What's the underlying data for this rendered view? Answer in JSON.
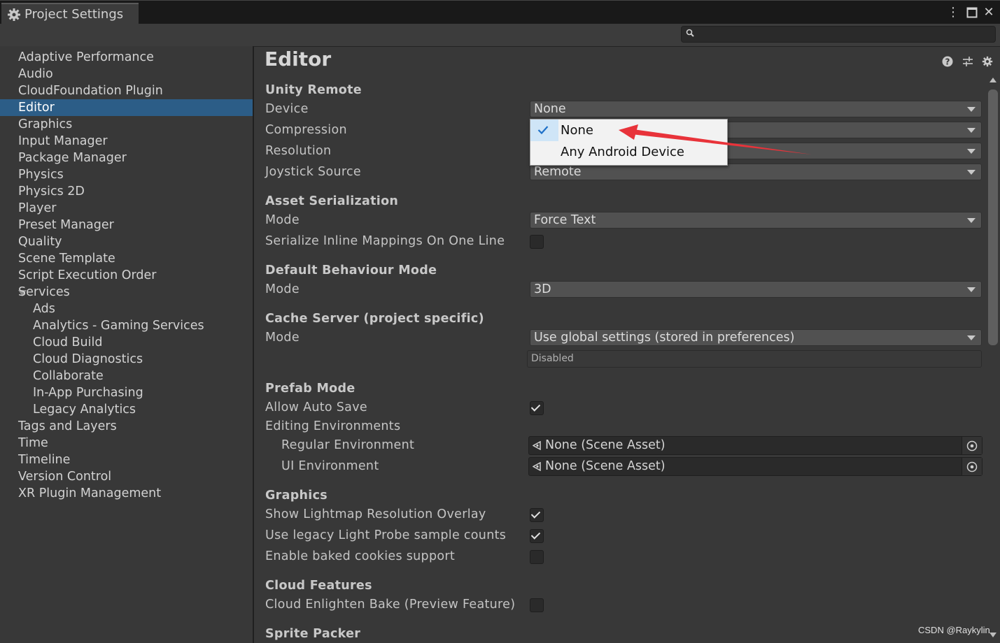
{
  "window": {
    "tab_title": "Project Settings",
    "buttons": [
      "menu-icon",
      "maximize-icon",
      "close-icon"
    ]
  },
  "search": {
    "placeholder": "",
    "value": ""
  },
  "sidebar": {
    "items": [
      {
        "label": "Adaptive Performance"
      },
      {
        "label": "Audio"
      },
      {
        "label": "CloudFoundation Plugin"
      },
      {
        "label": "Editor",
        "selected": true
      },
      {
        "label": "Graphics"
      },
      {
        "label": "Input Manager"
      },
      {
        "label": "Package Manager"
      },
      {
        "label": "Physics"
      },
      {
        "label": "Physics 2D"
      },
      {
        "label": "Player"
      },
      {
        "label": "Preset Manager"
      },
      {
        "label": "Quality"
      },
      {
        "label": "Scene Template"
      },
      {
        "label": "Script Execution Order"
      },
      {
        "label": "Services",
        "expanded": true
      },
      {
        "label": "Ads",
        "child": true
      },
      {
        "label": "Analytics - Gaming Services",
        "child": true
      },
      {
        "label": "Cloud Build",
        "child": true
      },
      {
        "label": "Cloud Diagnostics",
        "child": true
      },
      {
        "label": "Collaborate",
        "child": true
      },
      {
        "label": "In-App Purchasing",
        "child": true
      },
      {
        "label": "Legacy Analytics",
        "child": true
      },
      {
        "label": "Tags and Layers"
      },
      {
        "label": "Time"
      },
      {
        "label": "Timeline"
      },
      {
        "label": "Version Control"
      },
      {
        "label": "XR Plugin Management"
      }
    ]
  },
  "main": {
    "title": "Editor",
    "header_icons": [
      "help-icon",
      "preset-icon",
      "settings-gear-icon"
    ],
    "unity_remote": {
      "heading": "Unity Remote",
      "device_label": "Device",
      "device_value": "None",
      "compression_label": "Compression",
      "resolution_label": "Resolution",
      "joystick_label": "Joystick Source",
      "joystick_value": "Remote"
    },
    "asset_serialization": {
      "heading": "Asset Serialization",
      "mode_label": "Mode",
      "mode_value": "Force Text",
      "inline_label": "Serialize Inline Mappings On One Line",
      "inline_checked": false
    },
    "default_behaviour": {
      "heading": "Default Behaviour Mode",
      "mode_label": "Mode",
      "mode_value": "3D"
    },
    "cache_server": {
      "heading": "Cache Server (project specific)",
      "mode_label": "Mode",
      "mode_value": "Use global settings (stored in preferences)",
      "status": "Disabled"
    },
    "prefab_mode": {
      "heading": "Prefab Mode",
      "autosave_label": "Allow Auto Save",
      "autosave_checked": true,
      "editing_env_label": "Editing Environments",
      "regular_env_label": "Regular Environment",
      "regular_env_value": "None (Scene Asset)",
      "ui_env_label": "UI Environment",
      "ui_env_value": "None (Scene Asset)"
    },
    "graphics": {
      "heading": "Graphics",
      "lightmap_label": "Show Lightmap Resolution Overlay",
      "lightmap_checked": true,
      "lightprobe_label": "Use legacy Light Probe sample counts",
      "lightprobe_checked": true,
      "cookies_label": "Enable baked cookies support",
      "cookies_checked": false
    },
    "cloud_features": {
      "heading": "Cloud Features",
      "enlighten_label": "Cloud Enlighten Bake (Preview Feature)",
      "enlighten_checked": false
    },
    "sprite_packer": {
      "heading": "Sprite Packer"
    }
  },
  "device_popup": {
    "options": [
      {
        "label": "None",
        "checked": true
      },
      {
        "label": "Any Android Device",
        "checked": false
      }
    ]
  },
  "annotation_color": "#e8333a",
  "watermark": "CSDN @Raykylin"
}
